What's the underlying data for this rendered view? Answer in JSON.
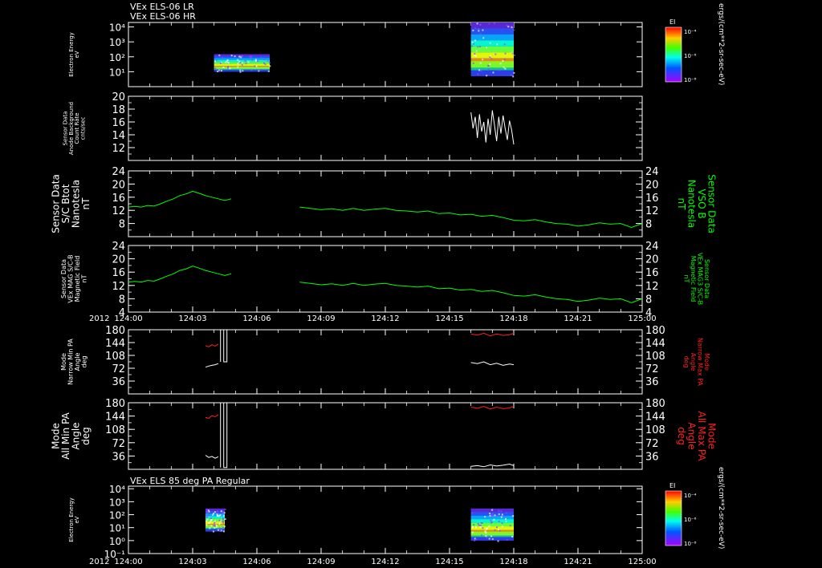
{
  "header": {
    "line1": "VEx ELS-06 LR",
    "line2": "VEx ELS-06 HR"
  },
  "panel7_title": "VEx ELS 85 deg PA Regular",
  "colorbar": {
    "label": "EI",
    "ticks": [
      "10⁻⁴",
      "10⁻⁶",
      "10⁻⁸"
    ],
    "units": "ergs/(cm**2-sr-sec-eV)"
  },
  "x_axis": {
    "year": "2012",
    "ticks": [
      "124:00",
      "124:03",
      "124:06",
      "124:09",
      "124:12",
      "124:15",
      "124:18",
      "124:21",
      "125:00"
    ]
  },
  "colors": {
    "green": "#00ff00",
    "red": "#ff2020",
    "white": "#ffffff"
  },
  "chart_data": [
    {
      "type": "heatmap",
      "ylabel": [
        "Electron Energy",
        "eV"
      ],
      "y_scale": "log",
      "ytick_labels": [
        "10⁴",
        "10³",
        "10²",
        "10¹"
      ],
      "data_windows": [
        {
          "x_start": "124:04.0",
          "x_end": "124:06.6",
          "energy_range_eV": [
            10,
            150
          ]
        },
        {
          "x_start": "124:16.0",
          "x_end": "124:18.0",
          "energy_range_eV": [
            5,
            20000
          ]
        }
      ]
    },
    {
      "type": "line",
      "ylabel": [
        "Sensor Data",
        "Anode Background",
        "Count Rate",
        "cnts/sec"
      ],
      "ylim": [
        10,
        20
      ],
      "yticks": [
        12,
        14,
        16,
        18,
        20
      ],
      "series": [
        {
          "color": "#ffffff",
          "x": [
            16.0,
            16.1,
            16.2,
            16.3,
            16.4,
            16.5,
            16.6,
            16.7,
            16.8,
            16.9,
            17.0,
            17.1,
            17.2,
            17.3,
            17.4,
            17.5,
            17.6,
            17.7,
            17.8,
            17.9,
            18.0
          ],
          "y": [
            17.5,
            15.0,
            16.8,
            13.5,
            17.2,
            14.5,
            16.0,
            12.8,
            16.5,
            14.0,
            17.8,
            15.5,
            13.0,
            16.8,
            14.2,
            17.0,
            15.0,
            13.2,
            16.2,
            14.8,
            12.5
          ]
        }
      ]
    },
    {
      "type": "line",
      "ylabel": [
        "Sensor Data",
        "S/C Btot",
        "Nanotesla",
        "nT"
      ],
      "ylabel_right": [
        "Sensor Data",
        "VSO B",
        "Nanotesla",
        "nT"
      ],
      "ylim": [
        4,
        24
      ],
      "yticks": [
        8,
        12,
        16,
        20,
        24
      ],
      "series": [
        {
          "color": "#00ff00",
          "x": [
            0,
            0.3,
            0.6,
            0.9,
            1.2,
            1.5,
            1.8,
            2.1,
            2.4,
            2.7,
            3.0,
            3.3,
            3.6,
            3.9,
            4.2,
            4.5,
            4.8
          ],
          "y": [
            13.0,
            13.2,
            13.0,
            13.5,
            13.3,
            14.0,
            14.8,
            15.5,
            16.5,
            17.0,
            17.8,
            17.2,
            16.5,
            16.0,
            15.5,
            15.0,
            15.5
          ]
        },
        {
          "color": "#00ff00",
          "x": [
            8.0,
            8.5,
            9.0,
            9.5,
            10.0,
            10.5,
            11.0,
            11.5,
            12.0,
            12.5,
            13.0,
            13.5,
            14.0,
            14.5,
            15.0,
            15.5,
            16.0,
            16.5,
            17.0,
            17.5,
            18.0,
            18.5,
            19.0,
            19.5,
            20.0,
            20.5,
            21.0,
            21.5,
            22.0,
            22.5,
            23.0,
            23.5,
            24.0
          ],
          "y": [
            13.0,
            12.6,
            12.2,
            12.5,
            12.0,
            12.6,
            12.0,
            12.4,
            12.6,
            12.0,
            11.8,
            11.5,
            11.8,
            11.0,
            11.2,
            10.6,
            10.8,
            10.2,
            10.5,
            9.8,
            9.0,
            8.8,
            9.2,
            8.5,
            8.0,
            7.8,
            7.2,
            7.6,
            8.2,
            7.8,
            8.0,
            6.8,
            8.0
          ]
        }
      ]
    },
    {
      "type": "line",
      "ylabel": [
        "Sensor Data",
        "VEx MAG S/C-B",
        "Magnetic Field",
        "nT"
      ],
      "ylabel_right": [
        "Sensor Data",
        "VEx MAG3 S/C-B",
        "Magnetic Field",
        "nT"
      ],
      "ylim": [
        4,
        24
      ],
      "yticks": [
        4,
        8,
        12,
        16,
        20,
        24
      ],
      "series": [
        {
          "color": "#00ff00",
          "x": [
            0,
            0.3,
            0.6,
            0.9,
            1.2,
            1.5,
            1.8,
            2.1,
            2.4,
            2.7,
            3.0,
            3.3,
            3.6,
            3.9,
            4.2,
            4.5,
            4.8
          ],
          "y": [
            13.0,
            13.2,
            13.0,
            13.5,
            13.3,
            14.0,
            14.8,
            15.5,
            16.5,
            17.0,
            17.8,
            17.2,
            16.5,
            16.0,
            15.5,
            15.0,
            15.5
          ]
        },
        {
          "color": "#00ff00",
          "x": [
            8.0,
            8.5,
            9.0,
            9.5,
            10.0,
            10.5,
            11.0,
            11.5,
            12.0,
            12.5,
            13.0,
            13.5,
            14.0,
            14.5,
            15.0,
            15.5,
            16.0,
            16.5,
            17.0,
            17.5,
            18.0,
            18.5,
            19.0,
            19.5,
            20.0,
            20.5,
            21.0,
            21.5,
            22.0,
            22.5,
            23.0,
            23.5,
            24.0
          ],
          "y": [
            13.0,
            12.6,
            12.2,
            12.5,
            12.0,
            12.6,
            12.0,
            12.4,
            12.6,
            12.0,
            11.8,
            11.5,
            11.8,
            11.0,
            11.2,
            10.6,
            10.8,
            10.2,
            10.5,
            9.8,
            9.0,
            8.8,
            9.2,
            8.5,
            8.0,
            7.8,
            7.2,
            7.6,
            8.2,
            7.8,
            8.0,
            6.8,
            8.0
          ]
        }
      ]
    },
    {
      "type": "line",
      "ylabel": [
        "Mode",
        "Narrow Min PA",
        "Angle",
        "deg"
      ],
      "ylabel_right": [
        "Mode",
        "Narrow Max PA",
        "Angle",
        "deg"
      ],
      "ylim": [
        0,
        180
      ],
      "yticks": [
        36,
        72,
        108,
        144,
        180
      ],
      "series": [
        {
          "color": "#ff2020",
          "x": [
            3.6,
            3.75,
            3.9,
            4.05,
            4.2
          ],
          "y": [
            135,
            132,
            138,
            134,
            140
          ]
        },
        {
          "color": "#ff2020",
          "x": [
            16.0,
            16.3,
            16.6,
            16.9,
            17.2,
            17.5,
            17.8,
            18.0
          ],
          "y": [
            168,
            165,
            170,
            163,
            168,
            164,
            166,
            170
          ]
        },
        {
          "color": "#ffffff",
          "x": [
            3.6,
            3.75,
            3.9,
            4.05,
            4.2
          ],
          "y": [
            75,
            78,
            80,
            82,
            85
          ]
        },
        {
          "color": "#ffffff",
          "x": [
            4.3,
            4.3,
            4.45,
            4.45,
            4.6,
            4.6
          ],
          "y": [
            90,
            180,
            180,
            90,
            90,
            180
          ]
        },
        {
          "color": "#ffffff",
          "x": [
            16.0,
            16.3,
            16.6,
            16.9,
            17.2,
            17.5,
            17.8,
            18.0
          ],
          "y": [
            88,
            85,
            90,
            82,
            86,
            80,
            84,
            82
          ]
        }
      ]
    },
    {
      "type": "line",
      "ylabel": [
        "Mode",
        "All Min PA",
        "Angle",
        "deg"
      ],
      "ylabel_right": [
        "Mode",
        "All Max PA",
        "Angle",
        "deg"
      ],
      "ylim": [
        0,
        180
      ],
      "yticks": [
        36,
        72,
        108,
        144,
        180
      ],
      "series": [
        {
          "color": "#ff2020",
          "x": [
            3.6,
            3.75,
            3.9,
            4.05,
            4.2
          ],
          "y": [
            140,
            138,
            145,
            142,
            148
          ]
        },
        {
          "color": "#ff2020",
          "x": [
            16.0,
            16.3,
            16.6,
            16.9,
            17.2,
            17.5,
            17.8,
            18.0
          ],
          "y": [
            168,
            165,
            170,
            163,
            168,
            164,
            166,
            170
          ]
        },
        {
          "color": "#ffffff",
          "x": [
            3.6,
            3.75,
            3.9,
            4.05,
            4.2
          ],
          "y": [
            38,
            32,
            35,
            30,
            34
          ]
        },
        {
          "color": "#ffffff",
          "x": [
            4.3,
            4.3,
            4.45,
            4.45,
            4.6,
            4.6
          ],
          "y": [
            5,
            180,
            180,
            5,
            5,
            180
          ]
        },
        {
          "color": "#ffffff",
          "x": [
            16.0,
            16.3,
            16.6,
            16.9,
            17.2,
            17.5,
            17.8,
            18.0
          ],
          "y": [
            8,
            10,
            7,
            12,
            9,
            11,
            14,
            10
          ]
        }
      ]
    },
    {
      "type": "heatmap",
      "ylabel": [
        "Electron Energy",
        "eV"
      ],
      "y_scale": "log",
      "ytick_labels": [
        "10⁴",
        "10³",
        "10²",
        "10¹",
        "10⁰",
        "10⁻¹"
      ],
      "data_windows": [
        {
          "x_start": "124:03.6",
          "x_end": "124:04.5",
          "energy_range_eV": [
            5,
            300
          ]
        },
        {
          "x_start": "124:16.0",
          "x_end": "124:18.0",
          "energy_range_eV": [
            1,
            300
          ]
        }
      ]
    }
  ]
}
